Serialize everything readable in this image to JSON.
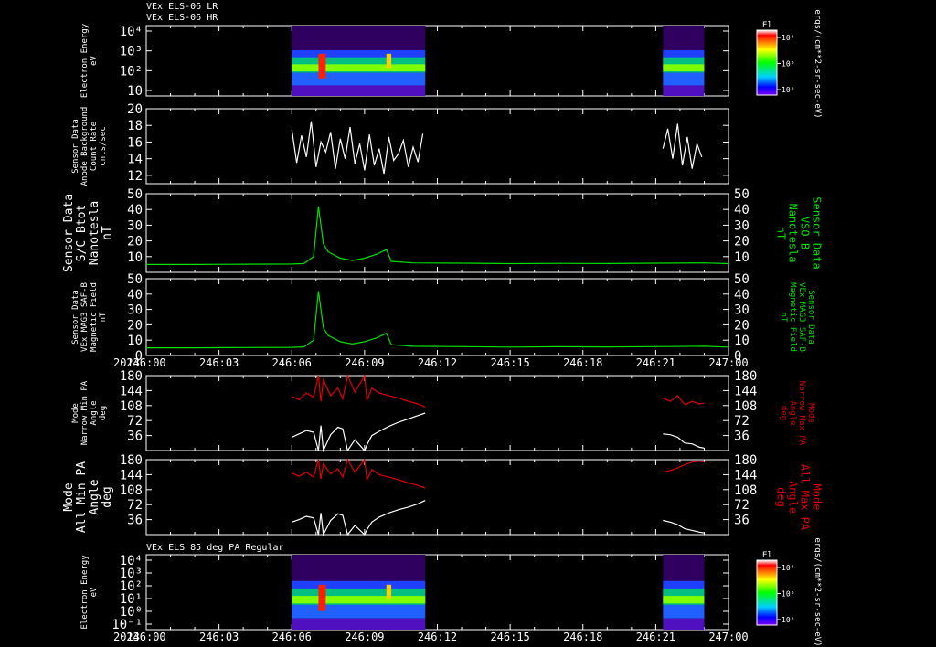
{
  "header": {
    "line1": "VEx ELS-06 LR",
    "line2": "VEx ELS-06 HR",
    "bottom_title": "VEx ELS 85 deg PA Regular"
  },
  "time_axis": {
    "year": "2013",
    "ticks": [
      "246:00",
      "246:03",
      "246:06",
      "246:09",
      "246:12",
      "246:15",
      "246:18",
      "246:21",
      "247:00"
    ]
  },
  "colorbars": [
    {
      "title": "El",
      "ticks": [
        "10⁴",
        "10⁶",
        "10⁸"
      ],
      "unit": "ergs/(cm**2-sr-sec-eV)"
    },
    {
      "title": "El",
      "ticks": [
        "10⁴",
        "10⁶",
        "10⁸"
      ],
      "unit": "ergs/(cm**2-sr-sec-eV)"
    }
  ],
  "colors": {
    "white": "#ffffff",
    "green": "#00e000",
    "red": "#e00000",
    "background": "#000000"
  },
  "chart_data": [
    {
      "type": "heatmap",
      "panel": "els-lr-hr-spectrogram",
      "ylabel_left": [
        "Electron Energy",
        "eV"
      ],
      "yticks": [
        "10⁴",
        "10³",
        "10²",
        "10"
      ],
      "ylog": true,
      "data_intervals": [
        [
          "246:06",
          "246:11.5"
        ],
        [
          "246:21.3",
          "246:23.0"
        ]
      ]
    },
    {
      "type": "line",
      "panel": "anode-background",
      "ylabel_left": [
        "Sensor Data",
        "Anode Background",
        "Count Rate",
        "cnts/sec"
      ],
      "yticks": [
        "20",
        "18",
        "16",
        "14",
        "12"
      ],
      "ylim": [
        11,
        20
      ],
      "series": [
        {
          "color": "#ffffff",
          "x": [
            6.0,
            6.2,
            6.4,
            6.6,
            6.8,
            7.0,
            7.2,
            7.4,
            7.6,
            7.8,
            8.0,
            8.2,
            8.4,
            8.6,
            8.8,
            9.0,
            9.2,
            9.4,
            9.6,
            9.8,
            10.0,
            10.2,
            10.4,
            10.6,
            10.8,
            11.0,
            11.2,
            11.4
          ],
          "y": [
            17.5,
            13.5,
            16.8,
            14.2,
            18.5,
            13.0,
            16.0,
            14.8,
            17.2,
            12.8,
            16.4,
            14.0,
            17.8,
            13.4,
            15.8,
            12.6,
            16.9,
            13.2,
            15.2,
            12.2,
            16.6,
            13.8,
            14.6,
            16.2,
            13.0,
            15.4,
            13.6,
            17.0
          ]
        },
        {
          "color": "#ffffff",
          "x": [
            21.3,
            21.5,
            21.7,
            21.9,
            22.1,
            22.3,
            22.5,
            22.7,
            22.9
          ],
          "y": [
            15.2,
            17.6,
            14.0,
            18.2,
            13.2,
            16.6,
            12.8,
            15.8,
            14.2
          ]
        }
      ]
    },
    {
      "type": "line",
      "panel": "sc-btot",
      "ylabel_left": [
        "Sensor Data",
        "S/C Btot",
        "Nanotesla",
        "nT"
      ],
      "ylabel_right": [
        "Sensor Data",
        "VSO B",
        "Nanotesla",
        "nT"
      ],
      "yticks": [
        "50",
        "40",
        "30",
        "20",
        "10"
      ],
      "ylim": [
        0,
        50
      ],
      "series": [
        {
          "color": "#00e000",
          "x": [
            0,
            2,
            4,
            6,
            6.5,
            6.9,
            7.1,
            7.3,
            7.5,
            8.0,
            8.5,
            9.0,
            9.5,
            9.9,
            10.1,
            11,
            13,
            15,
            17,
            19,
            21,
            23,
            24
          ],
          "y": [
            5,
            5,
            5.2,
            5.3,
            5.6,
            10,
            42,
            18,
            13,
            9,
            7.5,
            9,
            11.5,
            14.5,
            7,
            6,
            5.8,
            5.5,
            5.7,
            5.6,
            5.8,
            6,
            5.5
          ]
        }
      ]
    },
    {
      "type": "line",
      "panel": "mag-field",
      "ylabel_left": [
        "Sensor Data",
        "VEx MAG3 SAF-B",
        "Magnetic Field",
        "nT"
      ],
      "ylabel_right": [
        "Sensor Data",
        "VEx MAG3 SAF-B",
        "Magnetic Field",
        "nT"
      ],
      "yticks": [
        "50",
        "40",
        "30",
        "20",
        "10",
        "0"
      ],
      "ylim": [
        0,
        50
      ],
      "series": [
        {
          "color": "#00e000",
          "x": [
            0,
            2,
            4,
            6,
            6.5,
            6.9,
            7.1,
            7.3,
            7.5,
            8.0,
            8.5,
            9.0,
            9.5,
            9.9,
            10.1,
            11,
            13,
            15,
            17,
            19,
            21,
            23,
            24
          ],
          "y": [
            5,
            5,
            5.2,
            5.3,
            5.6,
            10,
            42,
            18,
            13,
            9,
            7.5,
            9,
            11.5,
            14.5,
            7,
            6,
            5.8,
            5.5,
            5.7,
            5.6,
            5.8,
            6,
            5.5
          ]
        }
      ]
    },
    {
      "type": "line",
      "panel": "narrow-pitch-angle",
      "ylabel_left": [
        "Mode",
        "Narrow Min PA",
        "Angle",
        "deg"
      ],
      "ylabel_right": [
        "Mode",
        "Narrow Max PA",
        "Angle",
        "deg"
      ],
      "yticks": [
        "180",
        "144",
        "108",
        "72",
        "36"
      ],
      "ylim": [
        0,
        180
      ],
      "series": [
        {
          "name": "Max PA",
          "color": "#e00000",
          "x": [
            6.0,
            6.3,
            6.6,
            6.9,
            7.1,
            7.2,
            7.3,
            7.6,
            7.9,
            8.1,
            8.3,
            8.6,
            9.0,
            9.1,
            9.3,
            9.6,
            10.0,
            10.4,
            10.8,
            11.2,
            11.5
          ],
          "y": [
            130,
            122,
            138,
            128,
            180,
            118,
            170,
            132,
            150,
            124,
            180,
            140,
            180,
            120,
            150,
            138,
            132,
            126,
            118,
            112,
            104
          ]
        },
        {
          "name": "Min PA",
          "color": "#ffffff",
          "x": [
            6.0,
            6.3,
            6.6,
            6.9,
            7.1,
            7.2,
            7.3,
            7.6,
            7.9,
            8.1,
            8.3,
            8.6,
            9.0,
            9.1,
            9.3,
            9.6,
            10.0,
            10.4,
            10.8,
            11.2,
            11.5
          ],
          "y": [
            32,
            40,
            48,
            44,
            0,
            60,
            0,
            38,
            56,
            52,
            0,
            26,
            0,
            14,
            36,
            46,
            58,
            68,
            76,
            84,
            90
          ]
        },
        {
          "name": "Max PA",
          "color": "#e00000",
          "x": [
            21.3,
            21.6,
            21.9,
            22.2,
            22.5,
            22.8,
            23.0
          ],
          "y": [
            126,
            118,
            132,
            110,
            118,
            112,
            114
          ]
        },
        {
          "name": "Min PA",
          "color": "#ffffff",
          "x": [
            21.3,
            21.6,
            21.9,
            22.2,
            22.5,
            22.8,
            23.0
          ],
          "y": [
            40,
            38,
            32,
            18,
            16,
            8,
            6
          ]
        }
      ]
    },
    {
      "type": "line",
      "panel": "all-pitch-angle",
      "ylabel_left": [
        "Mode",
        "All Min PA",
        "Angle",
        "deg"
      ],
      "ylabel_right": [
        "Mode",
        "All Max PA",
        "Angle",
        "deg"
      ],
      "yticks": [
        "180",
        "144",
        "108",
        "72",
        "36"
      ],
      "ylim": [
        0,
        180
      ],
      "series": [
        {
          "name": "Max PA",
          "color": "#e00000",
          "x": [
            6.0,
            6.3,
            6.6,
            6.9,
            7.1,
            7.2,
            7.3,
            7.6,
            7.9,
            8.1,
            8.3,
            8.6,
            9.0,
            9.1,
            9.3,
            9.6,
            10.0,
            10.4,
            10.8,
            11.2,
            11.5
          ],
          "y": [
            148,
            140,
            150,
            138,
            180,
            134,
            170,
            146,
            158,
            138,
            180,
            150,
            180,
            132,
            156,
            144,
            138,
            132,
            124,
            118,
            112
          ]
        },
        {
          "name": "Min PA",
          "color": "#ffffff",
          "x": [
            6.0,
            6.3,
            6.6,
            6.9,
            7.1,
            7.2,
            7.3,
            7.6,
            7.9,
            8.1,
            8.3,
            8.6,
            9.0,
            9.1,
            9.3,
            9.6,
            10.0,
            10.4,
            10.8,
            11.2,
            11.5
          ],
          "y": [
            30,
            36,
            44,
            40,
            0,
            52,
            0,
            34,
            50,
            46,
            0,
            22,
            0,
            12,
            30,
            42,
            52,
            60,
            66,
            74,
            82
          ]
        },
        {
          "name": "Max PA",
          "color": "#e00000",
          "x": [
            21.3,
            21.6,
            21.9,
            22.2,
            22.5,
            22.8,
            23.0
          ],
          "y": [
            150,
            154,
            160,
            168,
            174,
            176,
            174
          ]
        },
        {
          "name": "Min PA",
          "color": "#ffffff",
          "x": [
            21.3,
            21.6,
            21.9,
            22.2,
            22.5,
            22.8,
            23.0
          ],
          "y": [
            34,
            30,
            24,
            14,
            10,
            6,
            4
          ]
        }
      ]
    },
    {
      "type": "heatmap",
      "panel": "els-85deg-spectrogram",
      "ylabel_left": [
        "Electron Energy",
        "eV"
      ],
      "yticks": [
        "10⁴",
        "10³",
        "10²",
        "10¹",
        "10⁰",
        "10⁻¹"
      ],
      "ylog": true,
      "data_intervals": [
        [
          "246:06",
          "246:11.5"
        ],
        [
          "246:21.3",
          "246:23.0"
        ]
      ]
    }
  ]
}
